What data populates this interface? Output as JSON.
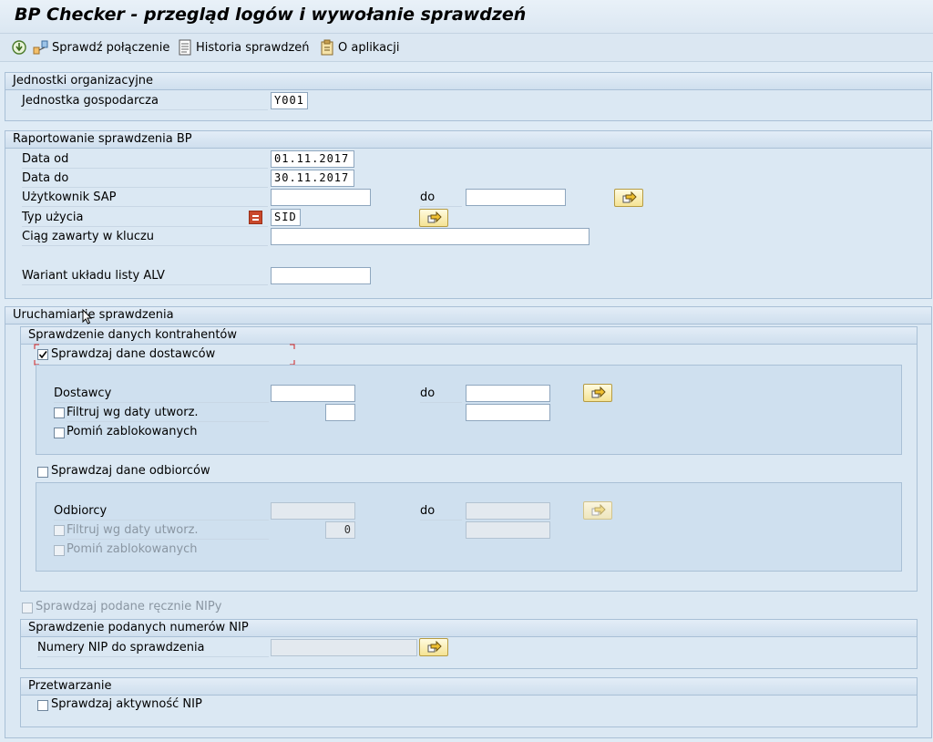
{
  "window": {
    "title": "BP Checker - przegląd logów i wywołanie sprawdzeń"
  },
  "toolbar": {
    "execute_icon": "execute-icon",
    "check_connection": "Sprawdź połączenie",
    "history": "Historia sprawdzeń",
    "about": "O aplikacji"
  },
  "org_units": {
    "title": "Jednostki organizacyjne",
    "company_code_label": "Jednostka gospodarcza",
    "company_code_value": "Y001"
  },
  "reporting": {
    "title": "Raportowanie sprawdzenia BP",
    "date_from_label": "Data od",
    "date_from_value": "01.11.2017",
    "date_to_label": "Data do",
    "date_to_value": "30.11.2017",
    "sap_user_label": "Użytkownik SAP",
    "sap_user_to_label": "do",
    "usage_type_label": "Typ użycia",
    "usage_type_value": "SID",
    "key_string_label": "Ciąg zawarty w kluczu",
    "alv_variant_label": "Wariant układu listy ALV"
  },
  "run_checks": {
    "title": "Uruchamianie sprawdzenia",
    "partner_data": {
      "title": "Sprawdzenie danych kontrahentów",
      "check_vendors_label": "Sprawdzaj dane dostawców",
      "check_vendors_checked": true,
      "vendors_label": "Dostawcy",
      "vendors_to_label": "do",
      "vendors_filter_label": "Filtruj wg daty utworz.",
      "vendors_skip_blocked_label": "Pomiń zablokowanych",
      "check_customers_label": "Sprawdzaj dane odbiorców",
      "customers_label": "Odbiorcy",
      "customers_to_label": "do",
      "customers_filter_label": "Filtruj wg daty utworz.",
      "customers_filter_value": "0",
      "customers_skip_blocked_label": "Pomiń zablokowanych"
    },
    "check_manual_nip_label": "Sprawdzaj podane ręcznie NIPy",
    "nip_check": {
      "title": "Sprawdzenie podanych numerów NIP",
      "nip_numbers_label": "Numery NIP do sprawdzenia"
    },
    "processing": {
      "title": "Przetwarzanie",
      "check_nip_activity_label": "Sprawdzaj aktywność NIP"
    }
  }
}
